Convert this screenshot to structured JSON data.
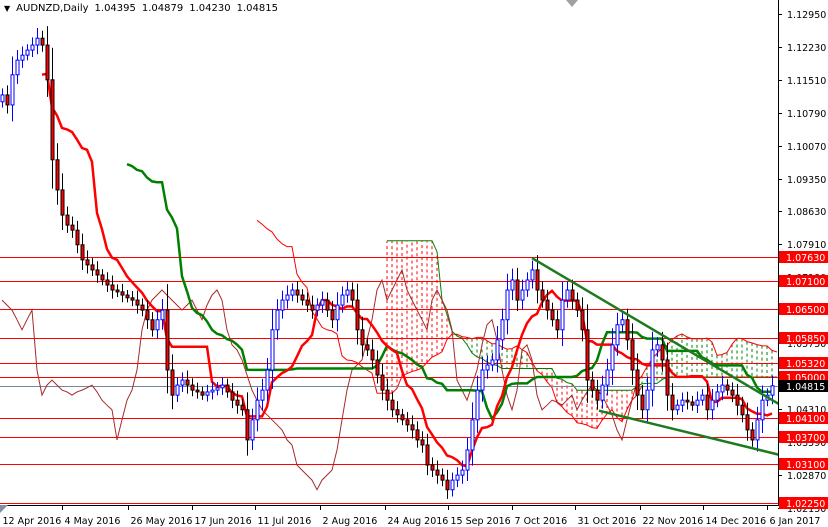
{
  "header": {
    "symbol": "AUDNZD,Daily",
    "open": "1.04395",
    "high": "1.04879",
    "low": "1.04230",
    "close": "1.04815"
  },
  "colors": {
    "bull": "#0000ff",
    "bear": "#ff0000",
    "tenkan": "#ff0000",
    "kijun": "#008000",
    "chikou": "#a52a2a",
    "level": "#ff0000",
    "trendline": "#1e7a1e",
    "price_line": "#778899"
  },
  "chart_data": {
    "type": "candlestick",
    "title": "AUDNZD,Daily",
    "indicator": "Ichimoku Kinko Hyo (9, 26, 52)",
    "ylim": [
      1.0205,
      1.1325
    ],
    "y_ticks": [
      "1.12950",
      "1.12230",
      "1.11510",
      "1.10790",
      "1.10070",
      "1.09350",
      "1.08630",
      "1.07910",
      "1.07190",
      "1.06470",
      "1.05750",
      "1.05030",
      "1.04310",
      "1.03590",
      "1.02870",
      "1.02150"
    ],
    "x_labels": [
      {
        "bar": 0,
        "label": "12 Apr 2016"
      },
      {
        "bar": 12.4,
        "label": "4 May 2016"
      },
      {
        "bar": 25.6,
        "label": "26 May 2016"
      },
      {
        "bar": 38.4,
        "label": "17 Jun 2016"
      },
      {
        "bar": 51,
        "label": "11 Jul 2016"
      },
      {
        "bar": 64,
        "label": "2 Aug 2016"
      },
      {
        "bar": 77,
        "label": "24 Aug 2016"
      },
      {
        "bar": 89.6,
        "label": "15 Sep 2016"
      },
      {
        "bar": 102.4,
        "label": "7 Oct 2016"
      },
      {
        "bar": 115,
        "label": "31 Oct 2016"
      },
      {
        "bar": 128,
        "label": "22 Nov 2016"
      },
      {
        "bar": 140.6,
        "label": "14 Dec 2016"
      },
      {
        "bar": 153.4,
        "label": "6 Jan 2017"
      }
    ],
    "close": [
      1.1118,
      1.1096,
      1.1162,
      1.1194,
      1.1205,
      1.1216,
      1.1227,
      1.1242,
      1.1227,
      1.1151,
      1.0976,
      1.091,
      1.0855,
      1.0833,
      1.0822,
      1.079,
      1.0757,
      1.0746,
      1.0735,
      1.0724,
      1.0713,
      1.0702,
      1.0691,
      1.0687,
      1.068,
      1.0674,
      1.0669,
      1.0658,
      1.0647,
      1.0626,
      1.0604,
      1.0626,
      1.0647,
      1.0516,
      1.0461,
      1.0483,
      1.0494,
      1.0483,
      1.0472,
      1.0468,
      1.0461,
      1.0468,
      1.0472,
      1.0477,
      1.0483,
      1.0468,
      1.045,
      1.0439,
      1.0429,
      1.0363,
      1.0407,
      1.045,
      1.0472,
      1.0516,
      1.0604,
      1.0647,
      1.0669,
      1.068,
      1.0691,
      1.068,
      1.0669,
      1.0658,
      1.0647,
      1.0658,
      1.0669,
      1.0647,
      1.0626,
      1.0658,
      1.068,
      1.0691,
      1.0669,
      1.0604,
      1.0571,
      1.056,
      1.0538,
      1.0505,
      1.0472,
      1.045,
      1.0429,
      1.0418,
      1.0407,
      1.0396,
      1.0385,
      1.0363,
      1.0352,
      1.0308,
      1.0297,
      1.0286,
      1.0275,
      1.0254,
      1.0275,
      1.0286,
      1.0297,
      1.0341,
      1.0407,
      1.0472,
      1.0516,
      1.0527,
      1.0538,
      1.0582,
      1.0626,
      1.0691,
      1.0713,
      1.0669,
      1.0691,
      1.0713,
      1.0735,
      1.0691,
      1.0669,
      1.0647,
      1.0626,
      1.0604,
      1.0669,
      1.0691,
      1.0669,
      1.0647,
      1.0604,
      1.0494,
      1.0472,
      1.045,
      1.0483,
      1.0516,
      1.0571,
      1.0615,
      1.0626,
      1.0582,
      1.0516,
      1.0461,
      1.0429,
      1.0472,
      1.056,
      1.0571,
      1.0538,
      1.0461,
      1.0429,
      1.0439,
      1.045,
      1.0446,
      1.0439,
      1.045,
      1.0461,
      1.0429,
      1.045,
      1.0468,
      1.0483,
      1.0472,
      1.0461,
      1.0439,
      1.0418,
      1.0385,
      1.0363,
      1.0407,
      1.045,
      1.0461,
      1.04815
    ],
    "levels": [
      "1.07630",
      "1.07100",
      "1.06500",
      "1.05850",
      "1.05320",
      "1.05000",
      "1.04100",
      "1.03700",
      "1.03100",
      "1.02250"
    ],
    "current_price": "1.04815",
    "trendlines": [
      {
        "name": "upper",
        "start": {
          "bar": 106,
          "price": 1.0761
        },
        "end": {
          "bar": 155.6,
          "price": 1.044
        }
      },
      {
        "name": "lower",
        "start": {
          "bar": 119.4,
          "price": 1.0427
        },
        "end": {
          "bar": 155.6,
          "price": 1.033
        }
      }
    ]
  }
}
